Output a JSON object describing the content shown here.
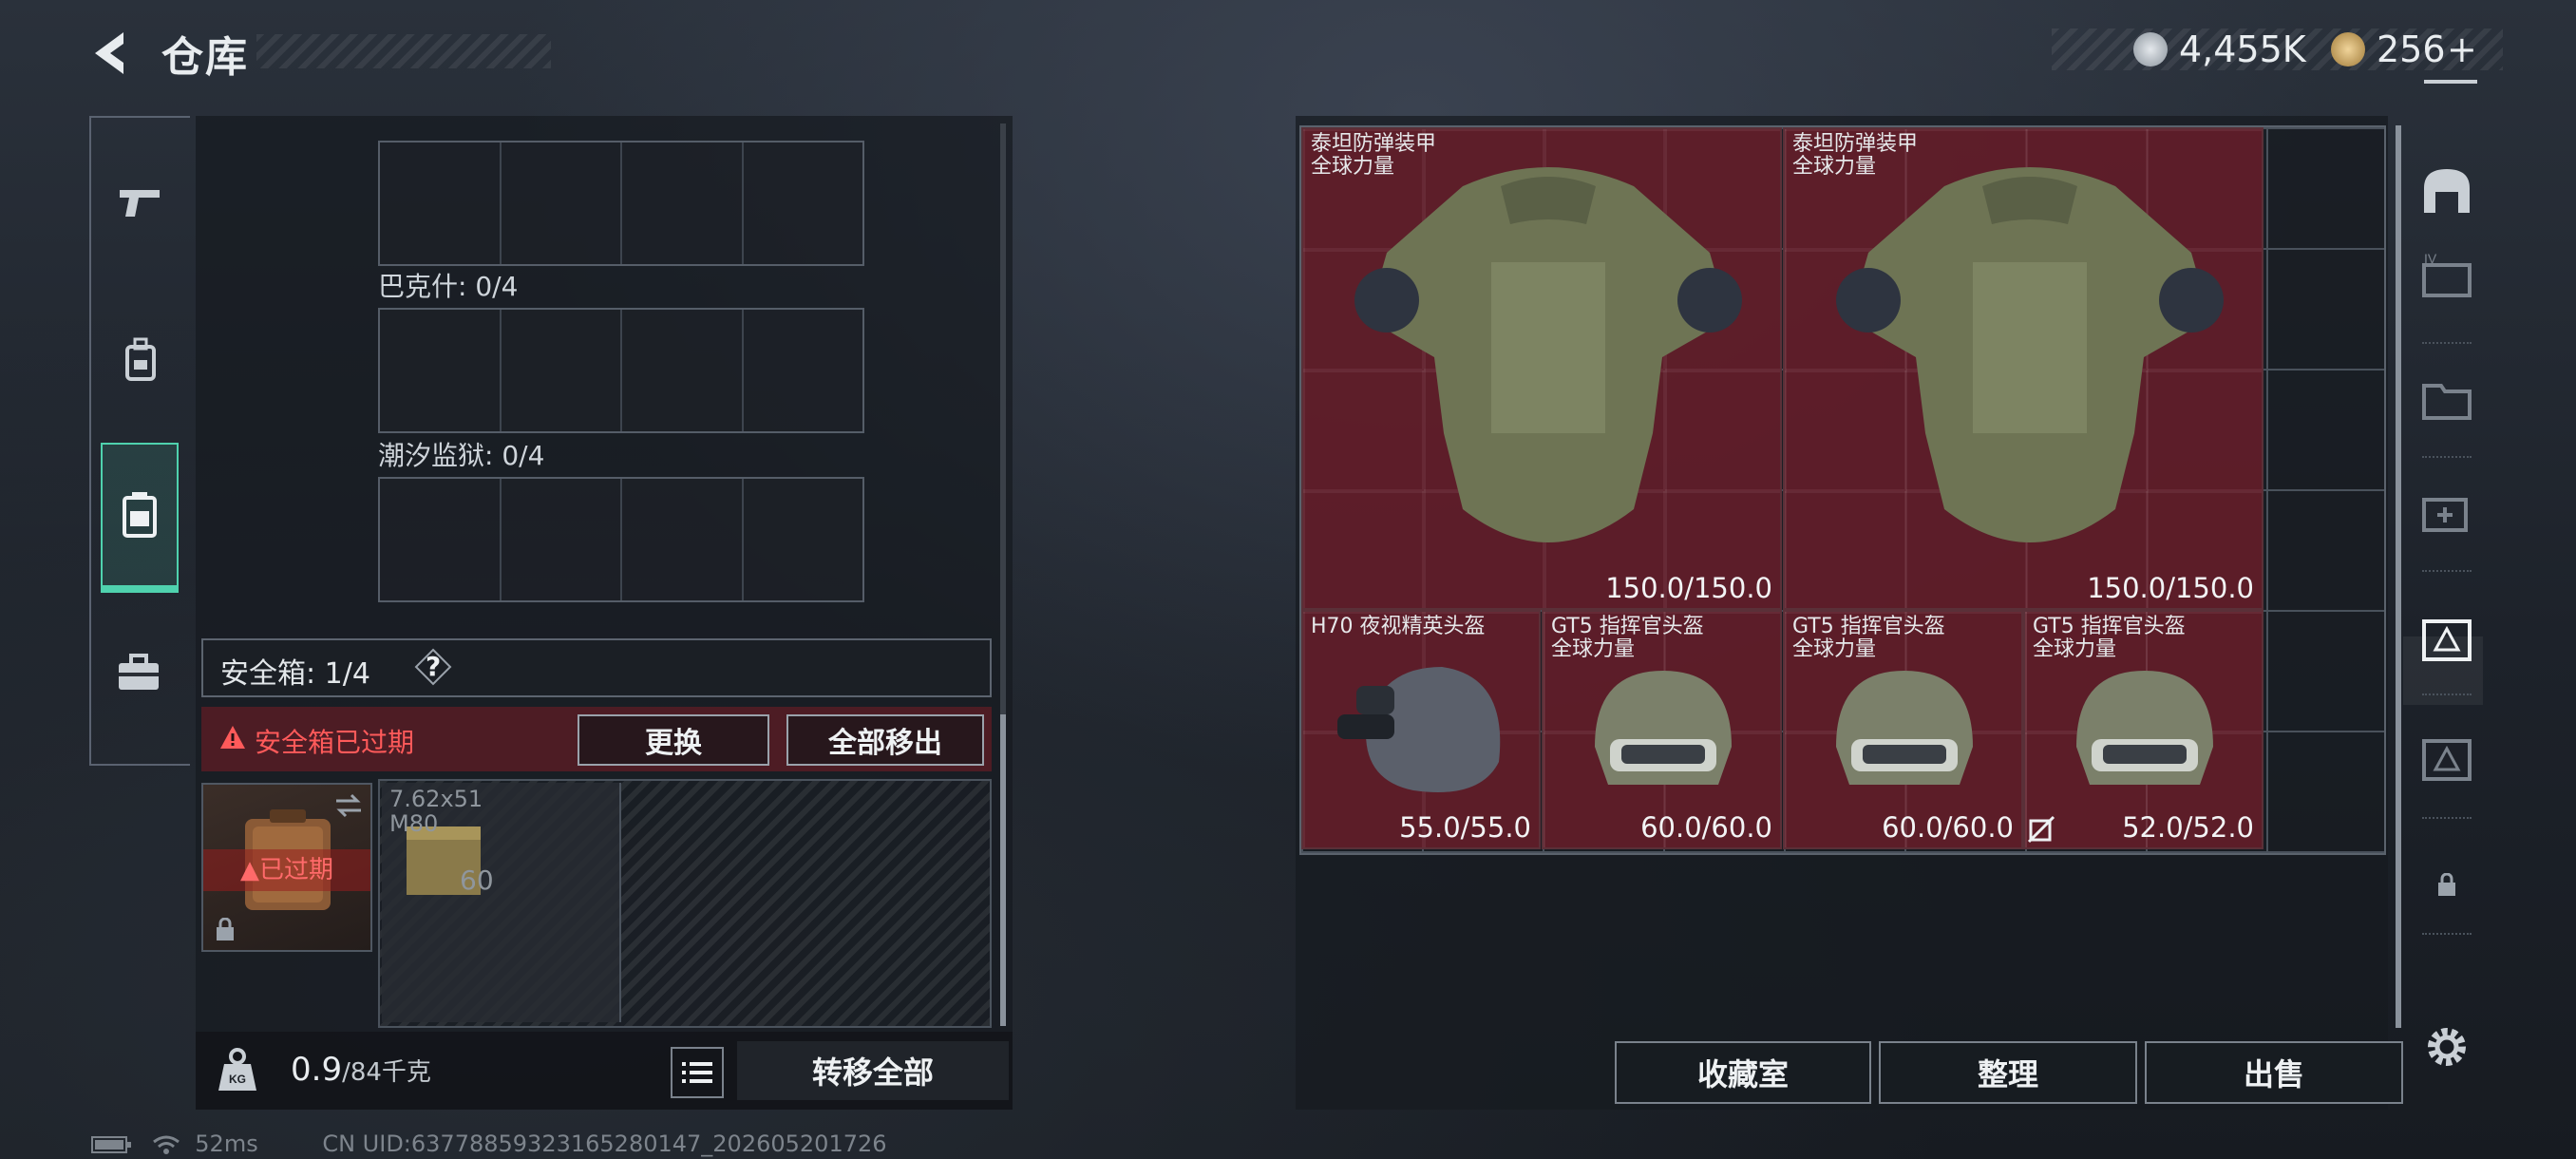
{
  "header": {
    "title": "仓库",
    "currency_primary": "4,455K",
    "currency_secondary": "256",
    "currency_secondary_add": "+"
  },
  "left_panel": {
    "bags": [
      {
        "label": "巴克什: 0/4"
      },
      {
        "label": "潮汐监狱: 0/4"
      }
    ],
    "safebox": {
      "label": "安全箱: 1/4",
      "help": "?",
      "expired_warning": "安全箱已过期",
      "replace_button": "更换",
      "move_all_button": "全部移出",
      "case_badge": "已过期",
      "ammo": {
        "name": "7.62x51 M80",
        "count": "60"
      }
    },
    "footer": {
      "weight": "0.9",
      "weight_max": "/84千克",
      "transfer_all": "转移全部"
    }
  },
  "stash": {
    "items": [
      {
        "name": "泰坦防弹装甲",
        "sub": "全球力量",
        "durability": "150.0/150.0",
        "icon": "armor-vest"
      },
      {
        "name": "泰坦防弹装甲",
        "sub": "全球力量",
        "durability": "150.0/150.0",
        "icon": "armor-vest"
      },
      {
        "name": "H70 夜视精英头盔",
        "sub": "",
        "durability": "55.0/55.0",
        "icon": "nvg-helmet"
      },
      {
        "name": "GT5 指挥官头盔",
        "sub": "全球力量",
        "durability": "60.0/60.0",
        "icon": "helmet"
      },
      {
        "name": "GT5 指挥官头盔",
        "sub": "全球力量",
        "durability": "60.0/60.0",
        "icon": "helmet"
      },
      {
        "name": "GT5 指挥官头盔",
        "sub": "全球力量",
        "durability": "52.0/52.0",
        "icon": "helmet"
      }
    ],
    "buttons": {
      "collection": "收藏室",
      "organize": "整理",
      "sell": "出售"
    }
  },
  "status_bar": {
    "ping": "52ms",
    "uid": "CN UID:6377885932316528014​7_202605201726"
  },
  "colors": {
    "accent": "#4fd2ae",
    "expired": "#ff5a5a",
    "item_bg": "#701e2a"
  }
}
